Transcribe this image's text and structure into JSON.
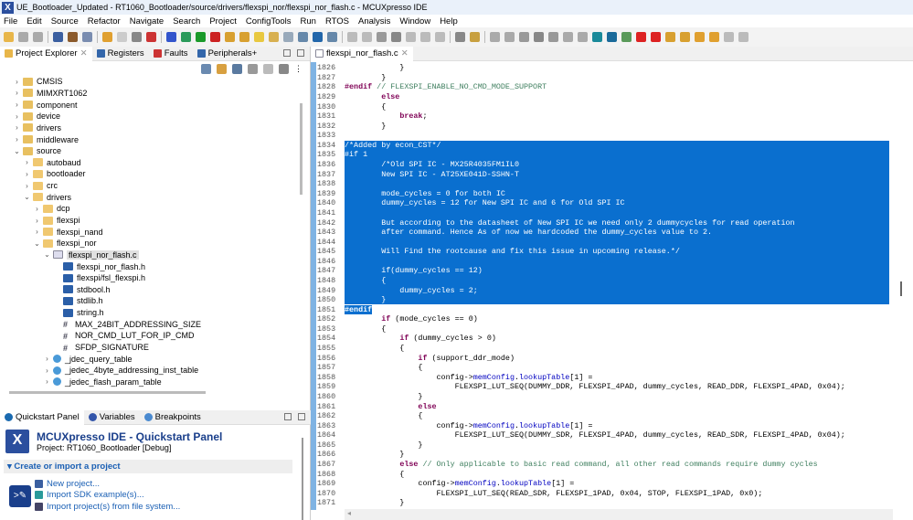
{
  "window": {
    "title": "UE_Bootloader_Updated - RT1060_Bootloader/source/drivers/flexspi_nor/flexspi_nor_flash.c - MCUXpresso IDE",
    "icon": "X"
  },
  "menu": [
    "File",
    "Edit",
    "Source",
    "Refactor",
    "Navigate",
    "Search",
    "Project",
    "ConfigTools",
    "Run",
    "RTOS",
    "Analysis",
    "Window",
    "Help"
  ],
  "toolbar": [
    {
      "name": "new-icon",
      "color": "#e8b64a"
    },
    {
      "name": "save-icon",
      "color": "#aaa"
    },
    {
      "name": "save-all-icon",
      "color": "#aaa"
    },
    {
      "name": "sep"
    },
    {
      "name": "build-settings-icon",
      "color": "#3b5fa0"
    },
    {
      "name": "build-icon",
      "color": "#8b5a2b"
    },
    {
      "name": "binary-icon",
      "color": "#7a8db0"
    },
    {
      "name": "sep"
    },
    {
      "name": "undo-icon",
      "color": "#e0a030"
    },
    {
      "name": "redo-icon",
      "color": "#ccc"
    },
    {
      "name": "clean-icon",
      "color": "#888"
    },
    {
      "name": "terminate-icon",
      "color": "#c33"
    },
    {
      "name": "sep"
    },
    {
      "name": "debug-icon",
      "color": "#3355cc"
    },
    {
      "name": "debug-config-icon",
      "color": "#2a9a5a"
    },
    {
      "name": "run-icon",
      "color": "#1a9a2a"
    },
    {
      "name": "run-external-icon",
      "color": "#c22"
    },
    {
      "name": "open-folder-icon",
      "color": "#d8a030"
    },
    {
      "name": "wizard-icon",
      "color": "#d8a030"
    },
    {
      "name": "highlight-icon",
      "color": "#e8c840"
    },
    {
      "name": "annotations-icon",
      "color": "#d8b050"
    },
    {
      "name": "block-icon",
      "color": "#9ab"
    },
    {
      "name": "pilcrow-icon",
      "color": "#6688aa"
    },
    {
      "name": "monitor-icon",
      "color": "#2266aa"
    },
    {
      "name": "skip-breakpoints-icon",
      "color": "#6688aa"
    },
    {
      "name": "sep"
    },
    {
      "name": "resume-icon",
      "color": "#bbb"
    },
    {
      "name": "suspend-icon",
      "color": "#bbb"
    },
    {
      "name": "stop-icon",
      "color": "#999"
    },
    {
      "name": "disconnect-icon",
      "color": "#888"
    },
    {
      "name": "step-into-icon",
      "color": "#bbb"
    },
    {
      "name": "step-over-icon",
      "color": "#bbb"
    },
    {
      "name": "step-return-icon",
      "color": "#bbb"
    },
    {
      "name": "sep"
    },
    {
      "name": "instruction-step-icon",
      "color": "#888"
    },
    {
      "name": "drop-frame-icon",
      "color": "#c8a040"
    },
    {
      "name": "sep"
    },
    {
      "name": "restart-icon",
      "color": "#aaa"
    },
    {
      "name": "pause-icon",
      "color": "#aaa"
    },
    {
      "name": "memory-icon",
      "color": "#999"
    },
    {
      "name": "step-icon",
      "color": "#888"
    },
    {
      "name": "refresh-icon",
      "color": "#999"
    },
    {
      "name": "reset-icon",
      "color": "#aaa"
    },
    {
      "name": "probe-icon",
      "color": "#aaa"
    },
    {
      "name": "mcux-icon",
      "color": "#1a8a9a"
    },
    {
      "name": "globe-icon",
      "color": "#1a6a9a"
    },
    {
      "name": "home-icon",
      "color": "#5a9a5a"
    },
    {
      "name": "link-icon",
      "color": "#d22"
    },
    {
      "name": "boot-icon",
      "color": "#d22"
    },
    {
      "name": "next-annotation-icon",
      "color": "#d8a030"
    },
    {
      "name": "prev-annotation-icon",
      "color": "#d8a030"
    },
    {
      "name": "back-history-icon",
      "color": "#e0a030"
    },
    {
      "name": "forward-history-icon",
      "color": "#e0a030"
    },
    {
      "name": "back-icon",
      "color": "#bbb"
    },
    {
      "name": "forward-icon",
      "color": "#bbb"
    }
  ],
  "left_tabs": [
    {
      "label": "Project Explorer",
      "icon": "folder-icon",
      "color": "#e8b64a",
      "active": true
    },
    {
      "label": "Registers",
      "icon": "registers-icon",
      "color": "#3366aa"
    },
    {
      "label": "Faults",
      "icon": "bug-icon",
      "color": "#cc3333"
    },
    {
      "label": "Peripherals+",
      "icon": "peripherals-icon",
      "color": "#3366aa"
    }
  ],
  "tree": [
    {
      "label": "CMSIS",
      "depth": 0,
      "exp": ">",
      "icon": "project-folder-icon"
    },
    {
      "label": "MIMXRT1062",
      "depth": 0,
      "exp": ">",
      "icon": "project-folder-icon"
    },
    {
      "label": "component",
      "depth": 0,
      "exp": ">",
      "icon": "project-folder-icon"
    },
    {
      "label": "device",
      "depth": 0,
      "exp": ">",
      "icon": "project-folder-icon"
    },
    {
      "label": "drivers",
      "depth": 0,
      "exp": ">",
      "icon": "project-folder-icon"
    },
    {
      "label": "middleware",
      "depth": 0,
      "exp": ">",
      "icon": "project-folder-icon"
    },
    {
      "label": "source",
      "depth": 0,
      "exp": "v",
      "icon": "project-folder-icon"
    },
    {
      "label": "autobaud",
      "depth": 1,
      "exp": ">",
      "icon": "folder-icon"
    },
    {
      "label": "bootloader",
      "depth": 1,
      "exp": ">",
      "icon": "folder-icon"
    },
    {
      "label": "crc",
      "depth": 1,
      "exp": ">",
      "icon": "folder-icon"
    },
    {
      "label": "drivers",
      "depth": 1,
      "exp": "v",
      "icon": "folder-icon"
    },
    {
      "label": "dcp",
      "depth": 2,
      "exp": ">",
      "icon": "folder-icon"
    },
    {
      "label": "flexspi",
      "depth": 2,
      "exp": ">",
      "icon": "folder-icon"
    },
    {
      "label": "flexspi_nand",
      "depth": 2,
      "exp": ">",
      "icon": "folder-icon"
    },
    {
      "label": "flexspi_nor",
      "depth": 2,
      "exp": "v",
      "icon": "folder-icon"
    },
    {
      "label": "flexspi_nor_flash.c",
      "depth": 3,
      "exp": "v",
      "icon": "c-file-icon",
      "selected": true
    },
    {
      "label": "flexspi_nor_flash.h",
      "depth": 4,
      "exp": "",
      "icon": "include-icon"
    },
    {
      "label": "flexspi/fsl_flexspi.h",
      "depth": 4,
      "exp": "",
      "icon": "include-icon"
    },
    {
      "label": "stdbool.h",
      "depth": 4,
      "exp": "",
      "icon": "include-icon"
    },
    {
      "label": "stdlib.h",
      "depth": 4,
      "exp": "",
      "icon": "include-icon"
    },
    {
      "label": "string.h",
      "depth": 4,
      "exp": "",
      "icon": "include-icon"
    },
    {
      "label": "MAX_24BIT_ADDRESSING_SIZE",
      "depth": 4,
      "exp": "",
      "icon": "macro-icon"
    },
    {
      "label": "NOR_CMD_LUT_FOR_IP_CMD",
      "depth": 4,
      "exp": "",
      "icon": "macro-icon"
    },
    {
      "label": "SFDP_SIGNATURE",
      "depth": 4,
      "exp": "",
      "icon": "macro-icon"
    },
    {
      "label": "_jdec_query_table",
      "depth": 3,
      "exp": ">",
      "icon": "struct-icon"
    },
    {
      "label": "_jedec_4byte_addressing_inst_table",
      "depth": 3,
      "exp": ">",
      "icon": "struct-icon"
    },
    {
      "label": "_jedec_flash_param_table",
      "depth": 3,
      "exp": ">",
      "icon": "struct-icon"
    }
  ],
  "quickstart": {
    "tabs": [
      {
        "label": "Quickstart Panel",
        "icon": "power-icon",
        "active": true
      },
      {
        "label": "Variables",
        "icon": "variables-icon"
      },
      {
        "label": "Breakpoints",
        "icon": "breakpoints-icon"
      }
    ],
    "title": "MCUXpresso IDE - Quickstart Panel",
    "project": "Project: RT1060_Bootloader [Debug]",
    "section": "Create or import a project",
    "links": [
      {
        "label": "New project...",
        "icon": "new-project-icon",
        "color": "#3b5fa0"
      },
      {
        "label": "Import SDK example(s)...",
        "icon": "import-sdk-icon",
        "color": "#2a9a9a"
      },
      {
        "label": "Import project(s) from file system...",
        "icon": "import-fs-icon",
        "color": "#446"
      }
    ]
  },
  "editor": {
    "tab": "flexspi_nor_flash.c",
    "lines": [
      {
        "n": "1826",
        "t": [
          [
            "            }",
            ""
          ]
        ]
      },
      {
        "n": "1827",
        "t": [
          [
            "        }",
            ""
          ]
        ]
      },
      {
        "n": "1828",
        "t": [
          [
            "#endif",
            "kw"
          ],
          [
            " // FLEXSPI_ENABLE_NO_CMD_MODE_SUPPORT",
            "cm"
          ]
        ]
      },
      {
        "n": "1829",
        "t": [
          [
            "        ",
            ""
          ],
          [
            "else",
            "kw"
          ]
        ]
      },
      {
        "n": "1830",
        "t": [
          [
            "        {",
            ""
          ]
        ]
      },
      {
        "n": "1831",
        "t": [
          [
            "            ",
            ""
          ],
          [
            "break",
            "kw"
          ],
          [
            ";",
            ""
          ]
        ]
      },
      {
        "n": "1832",
        "t": [
          [
            "        }",
            ""
          ]
        ]
      },
      {
        "n": "1833",
        "t": [
          [
            "",
            ""
          ]
        ]
      },
      {
        "n": "1834",
        "sel": true,
        "t": [
          [
            "/*Added by econ_CST*/",
            ""
          ]
        ]
      },
      {
        "n": "1835",
        "sel": true,
        "t": [
          [
            "#if 1",
            ""
          ]
        ]
      },
      {
        "n": "1836",
        "sel": true,
        "t": [
          [
            "        /*Old SPI IC - MX25R4035FM1IL0",
            ""
          ]
        ]
      },
      {
        "n": "1837",
        "sel": true,
        "t": [
          [
            "        New SPI IC - AT25XE041D-SSHN-T",
            ""
          ]
        ]
      },
      {
        "n": "1838",
        "sel": true,
        "t": [
          [
            "",
            ""
          ]
        ]
      },
      {
        "n": "1839",
        "sel": true,
        "t": [
          [
            "        mode_cycles = 0 for both IC",
            ""
          ]
        ]
      },
      {
        "n": "1840",
        "sel": true,
        "t": [
          [
            "        dummy_cycles = 12 for New SPI IC and 6 for Old SPI IC",
            ""
          ]
        ]
      },
      {
        "n": "1841",
        "sel": true,
        "t": [
          [
            "",
            ""
          ]
        ]
      },
      {
        "n": "1842",
        "sel": true,
        "t": [
          [
            "        But according to the datasheet of New SPI IC we need only 2 dummycycles for read operation",
            ""
          ]
        ]
      },
      {
        "n": "1843",
        "sel": true,
        "t": [
          [
            "        after command. Hence As of now we hardcoded the dummy_cycles value to 2.",
            ""
          ]
        ]
      },
      {
        "n": "1844",
        "sel": true,
        "t": [
          [
            "",
            ""
          ]
        ]
      },
      {
        "n": "1845",
        "sel": true,
        "t": [
          [
            "        Will Find the rootcause and fix this issue in upcoming release.*/",
            ""
          ]
        ]
      },
      {
        "n": "1846",
        "sel": true,
        "t": [
          [
            "",
            ""
          ]
        ]
      },
      {
        "n": "1847",
        "sel": true,
        "t": [
          [
            "        if(dummy_cycles == 12)",
            ""
          ]
        ]
      },
      {
        "n": "1848",
        "sel": true,
        "t": [
          [
            "        {",
            ""
          ]
        ]
      },
      {
        "n": "1849",
        "sel": true,
        "t": [
          [
            "            dummy_cycles = 2;",
            ""
          ]
        ]
      },
      {
        "n": "1850",
        "sel": true,
        "t": [
          [
            "        }",
            ""
          ]
        ]
      },
      {
        "n": "1851",
        "partial": true,
        "t": [
          [
            "#endif",
            "kw"
          ]
        ]
      },
      {
        "n": "1852",
        "t": [
          [
            "        ",
            ""
          ],
          [
            "if",
            "kw"
          ],
          [
            " (mode_cycles == 0)",
            ""
          ]
        ]
      },
      {
        "n": "1853",
        "t": [
          [
            "        {",
            ""
          ]
        ]
      },
      {
        "n": "1854",
        "t": [
          [
            "            ",
            ""
          ],
          [
            "if",
            "kw"
          ],
          [
            " (dummy_cycles > 0)",
            ""
          ]
        ]
      },
      {
        "n": "1855",
        "t": [
          [
            "            {",
            ""
          ]
        ]
      },
      {
        "n": "1856",
        "t": [
          [
            "                ",
            ""
          ],
          [
            "if",
            "kw"
          ],
          [
            " (support_ddr_mode)",
            ""
          ]
        ]
      },
      {
        "n": "1857",
        "t": [
          [
            "                {",
            ""
          ]
        ]
      },
      {
        "n": "1858",
        "t": [
          [
            "                    config->",
            ""
          ],
          [
            "memConfig",
            "fld"
          ],
          [
            ".",
            ""
          ],
          [
            "lookupTable",
            "fld"
          ],
          [
            "[1] =",
            ""
          ]
        ]
      },
      {
        "n": "1859",
        "t": [
          [
            "                        FLEXSPI_LUT_SEQ(DUMMY_DDR, FLEXSPI_4PAD, dummy_cycles, READ_DDR, FLEXSPI_4PAD, 0x04);",
            ""
          ]
        ]
      },
      {
        "n": "1860",
        "t": [
          [
            "                }",
            ""
          ]
        ]
      },
      {
        "n": "1861",
        "t": [
          [
            "                ",
            ""
          ],
          [
            "else",
            "kw"
          ]
        ]
      },
      {
        "n": "1862",
        "t": [
          [
            "                {",
            ""
          ]
        ]
      },
      {
        "n": "1863",
        "t": [
          [
            "                    config->",
            ""
          ],
          [
            "memConfig",
            "fld"
          ],
          [
            ".",
            ""
          ],
          [
            "lookupTable",
            "fld"
          ],
          [
            "[1] =",
            ""
          ]
        ]
      },
      {
        "n": "1864",
        "t": [
          [
            "                        FLEXSPI_LUT_SEQ(DUMMY_SDR, FLEXSPI_4PAD, dummy_cycles, READ_SDR, FLEXSPI_4PAD, 0x04);",
            ""
          ]
        ]
      },
      {
        "n": "1865",
        "t": [
          [
            "                }",
            ""
          ]
        ]
      },
      {
        "n": "1866",
        "t": [
          [
            "            }",
            ""
          ]
        ]
      },
      {
        "n": "1867",
        "t": [
          [
            "            ",
            ""
          ],
          [
            "else",
            "kw"
          ],
          [
            " // Only applicable to basic read command, all other read commands require dummy cycles",
            "cm"
          ]
        ]
      },
      {
        "n": "1868",
        "t": [
          [
            "            {",
            ""
          ]
        ]
      },
      {
        "n": "1869",
        "t": [
          [
            "                config->",
            ""
          ],
          [
            "memConfig",
            "fld"
          ],
          [
            ".",
            ""
          ],
          [
            "lookupTable",
            "fld"
          ],
          [
            "[1] =",
            ""
          ]
        ]
      },
      {
        "n": "1870",
        "t": [
          [
            "                    FLEXSPI_LUT_SEQ(READ_SDR, FLEXSPI_1PAD, 0x04, STOP, FLEXSPI_1PAD, 0x0);",
            ""
          ]
        ]
      },
      {
        "n": "1871",
        "t": [
          [
            "            }",
            ""
          ]
        ]
      }
    ]
  }
}
